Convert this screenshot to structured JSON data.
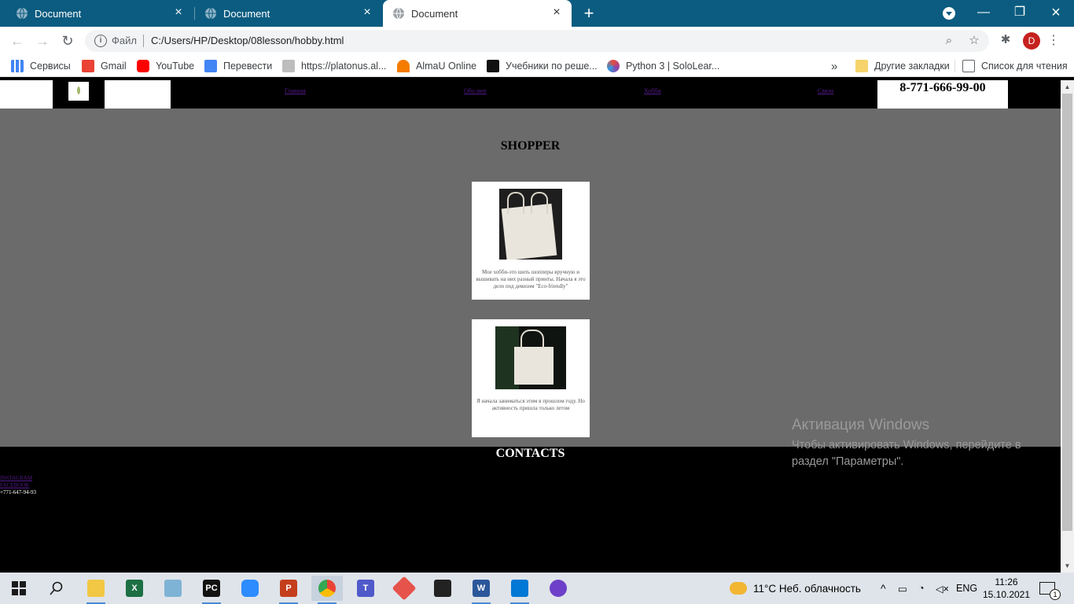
{
  "browser": {
    "tabs": [
      {
        "title": "Document",
        "active": false
      },
      {
        "title": "Document",
        "active": false
      },
      {
        "title": "Document",
        "active": true
      }
    ],
    "new_tab_label": "+",
    "address": {
      "scheme_label": "Файл",
      "url": "C:/Users/HP/Desktop/08lesson/hobby.html"
    },
    "profile_initial": "D",
    "bookmarks": [
      {
        "label": "Сервисы",
        "icon": "apps-grid-icon",
        "color": "#4285f4"
      },
      {
        "label": "Gmail",
        "icon": "gmail-icon",
        "color": "#ea4335"
      },
      {
        "label": "YouTube",
        "icon": "youtube-icon",
        "color": "#ff0000"
      },
      {
        "label": "Перевести",
        "icon": "translate-icon",
        "color": "#4285f4"
      },
      {
        "label": "https://platonus.al...",
        "icon": "platonus-icon",
        "color": "#9e9e9e"
      },
      {
        "label": "AlmaU Online",
        "icon": "almau-icon",
        "color": "#f57c00"
      },
      {
        "label": "Учебники по реше...",
        "icon": "textbooks-icon",
        "color": "#111111"
      },
      {
        "label": "Python 3 | SoloLear...",
        "icon": "sololearn-icon",
        "color": "#8e44ad"
      }
    ],
    "more_bookmarks_label": "»",
    "other_bookmarks": "Другие закладки",
    "reading_list": "Список для чтения"
  },
  "site": {
    "nav": [
      "Главная",
      "Обо мне",
      "Хобби",
      "Связи"
    ],
    "phone": "8-771-666-99-00",
    "title": "SHOPPER",
    "cards": [
      {
        "text": "Мое хобби-это шить шопперы вручную и вышивать на них разный принты. Начала я это дело под девизом \"Eco-friendly\""
      },
      {
        "text": "Я начала заниматься этим в прошлом году. Но активность пришла только летом"
      }
    ],
    "contacts_title": "CONTACTS",
    "contact_links": [
      "INSTAGRAM",
      "FACEBOOK"
    ],
    "contact_phone": "+771-647-94-93"
  },
  "activation": {
    "title": "Активация Windows",
    "message": "Чтобы активировать Windows, перейдите в раздел \"Параметры\"."
  },
  "taskbar": {
    "apps": [
      {
        "name": "file-explorer-icon",
        "label": "",
        "color": "#f2c744"
      },
      {
        "name": "excel-icon",
        "label": "X",
        "color": "#1d7044"
      },
      {
        "name": "paint-icon",
        "label": "",
        "color": "#7fb3d5"
      },
      {
        "name": "pycharm-icon",
        "label": "PC",
        "color": "#111111"
      },
      {
        "name": "zoom-icon",
        "label": "",
        "color": "#2d8cff"
      },
      {
        "name": "powerpoint-icon",
        "label": "P",
        "color": "#c43e1c"
      },
      {
        "name": "chrome-icon",
        "label": "",
        "color": "#4285f4"
      },
      {
        "name": "teams-icon",
        "label": "T",
        "color": "#5059c9"
      },
      {
        "name": "git-icon",
        "label": "",
        "color": "#e5534b"
      },
      {
        "name": "figma-icon",
        "label": "",
        "color": "#222222"
      },
      {
        "name": "word-icon",
        "label": "W",
        "color": "#2b579a"
      },
      {
        "name": "vscode-icon",
        "label": "",
        "color": "#0078d4"
      },
      {
        "name": "github-desktop-icon",
        "label": "",
        "color": "#6e40c9"
      }
    ],
    "weather": "11°C  Неб. облачность",
    "language": "ENG",
    "time": "11:26",
    "date": "15.10.2021",
    "notification_count": "1"
  }
}
